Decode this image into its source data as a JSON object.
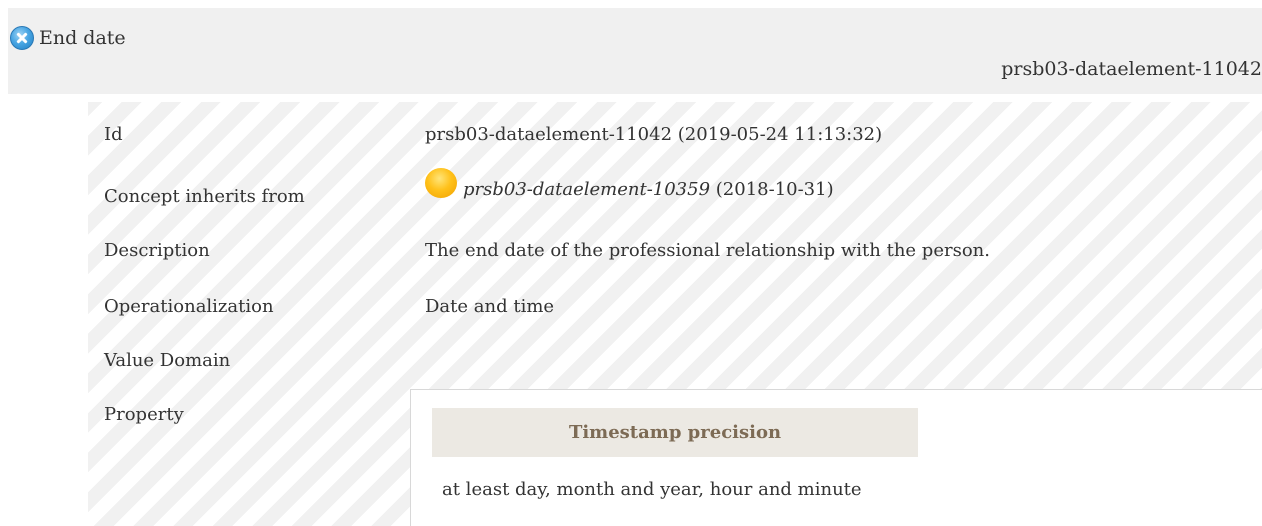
{
  "header": {
    "title": "End date",
    "id": "prsb03-dataelement-11042"
  },
  "rows": {
    "id": {
      "label": "Id",
      "value": "prsb03-dataelement-11042 (2019-05-24 11:13:32)"
    },
    "inherits": {
      "label": "Concept inherits from",
      "link": "prsb03-dataelement-10359",
      "date": "(2018-10-31)"
    },
    "description": {
      "label": "Description",
      "value": "The end date of the professional relationship with the person."
    },
    "operationalization": {
      "label": "Operationalization",
      "value": "Date and time"
    },
    "value_domain": {
      "label": "Value Domain"
    },
    "property": {
      "label": "Property",
      "header": "Timestamp precision",
      "value": "at least day, month and year, hour and minute"
    }
  },
  "icons": {
    "header_icon": "close-icon",
    "status_icon": "status-dot-icon"
  },
  "colors": {
    "header_bg": "#f0f0f0",
    "property_header_bg": "#ece9e3",
    "property_header_text": "#7d6b55",
    "status_dot": "#ffc11a",
    "close_icon": "#4aa6e3"
  }
}
